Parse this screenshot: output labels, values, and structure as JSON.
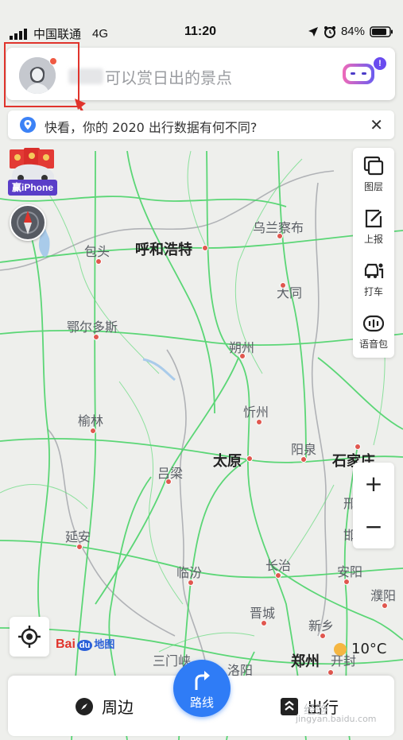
{
  "status_bar": {
    "carrier": "中国联通",
    "network": "4G",
    "time": "11:20",
    "battery": "84%"
  },
  "search": {
    "placeholder": "可以赏日出的景点"
  },
  "notice": {
    "text": "快看，你的 2020 出行数据有何不同?",
    "close": "✕"
  },
  "promo": {
    "label": "赢iPhone"
  },
  "toolbar": {
    "layers": "图层",
    "report": "上报",
    "taxi": "打车",
    "voice": "语音包"
  },
  "zoom": {
    "in": "+",
    "out": "−"
  },
  "map": {
    "cities": [
      {
        "name": "包头"
      },
      {
        "name": "呼和浩特",
        "major": true
      },
      {
        "name": "乌兰察布"
      },
      {
        "name": "大同"
      },
      {
        "name": "鄂尔多斯"
      },
      {
        "name": "朔州"
      },
      {
        "name": "忻州"
      },
      {
        "name": "榆林"
      },
      {
        "name": "吕梁"
      },
      {
        "name": "太原",
        "major": true
      },
      {
        "name": "阳泉"
      },
      {
        "name": "石家庄",
        "major": true
      },
      {
        "name": "延安"
      },
      {
        "name": "临汾"
      },
      {
        "name": "长治"
      },
      {
        "name": "晋城"
      },
      {
        "name": "安阳"
      },
      {
        "name": "濮阳"
      },
      {
        "name": "新乡"
      },
      {
        "name": "三门峡"
      },
      {
        "name": "洛阳"
      },
      {
        "name": "郑州",
        "major": true
      },
      {
        "name": "开封"
      },
      {
        "name": "邢"
      },
      {
        "name": "邯"
      }
    ]
  },
  "logo": {
    "bai": "Bai",
    "du": "du",
    "ditu": "地图"
  },
  "weather": {
    "temp": "10°C"
  },
  "bottom": {
    "nearby": "周边",
    "route": "路线",
    "trip": "出行"
  },
  "watermark": {
    "line1": "经验",
    "line2": "jingyan.baidu.com"
  },
  "colors": {
    "road": "#4cd46a",
    "accent": "#2f7cf6",
    "highlight": "#e0342c"
  }
}
